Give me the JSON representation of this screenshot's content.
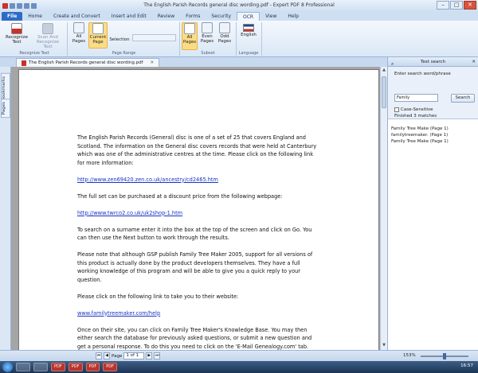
{
  "window": {
    "title": "The English Parish Records general disc wording.pdf - Expert PDF 8 Professional",
    "minimize": "–",
    "maximize": "□",
    "close": "✕"
  },
  "ribbon_tabs": [
    "File",
    "Home",
    "Create and Convert",
    "Insert and Edit",
    "Review",
    "Forms",
    "Security",
    "OCR",
    "View",
    "Help"
  ],
  "active_tab": "OCR",
  "ribbon": {
    "recognize_text": "Recognize Text",
    "scan_and_recognize": "Scan And Recognize Text",
    "group_recognize": "Recognize Text",
    "all_pages": "All Pages",
    "current_page": "Current Page",
    "selection": "Selection",
    "group_page_range": "Page Range",
    "subset_all": "All Pages",
    "subset_even": "Even Pages",
    "subset_odd": "Odd Pages",
    "group_subset": "Subset",
    "language": "English",
    "group_language": "Language"
  },
  "doc_tab": "The English Parish Records general disc wording.pdf",
  "left_tabs": {
    "bookmarks": "Bookmarks",
    "pages": "Pages"
  },
  "document": {
    "p1": "The English Parish Records (General) disc is one of a set of 25 that covers England and Scotland. The information on the General disc covers records that were held at Canterbury which was one of the administrative centres at the time. Please click on the following link for more information:",
    "link1": "http://www.zen69420.zen.co.uk/ancestry/cd2465.htm",
    "p2": "The full set can be purchased at a discount price from the following webpage:",
    "link2": "http://www.twrco2.co.uk/uk2shop-1.htm",
    "p3": "To search on a surname enter it into the box at the top of the screen and click on Go. You can then use the Next button to work through the results.",
    "p4": "Please note that although GSP publish Family Tree Maker 2005, support for all versions of this product is actually done by the product developers themselves. They have a full working knowledge of this program and will be able to give you a quick reply to your question.",
    "p5": "Please click on the following link to take you to their website:",
    "link3": "www.familytreemaker.com/help",
    "p6": "Once on their site, you can click on Family Tree Maker's Knowledge Base. You may then either search the database for previously asked questions, or submit a new question and get a personal response. To do this you need to click on the 'E-Mail Genealogy.com' tab. From here you can complete an enquiry form that goes straight to the FTM technicians."
  },
  "search_panel": {
    "title": "Text search",
    "label": "Enter search word/phrase",
    "query": "Family",
    "button": "Search",
    "case_sensitive": "Case-Sensitive",
    "status": "Finished 3 matches",
    "results": [
      "Family Tree Make (Page 1)",
      "familytreemaker. (Page 1)",
      "Family Tree Make (Page 1)"
    ]
  },
  "status": {
    "page_label": "Page",
    "page_value": "1 of 1",
    "zoom": "153%"
  },
  "taskbar": {
    "items": [
      "PDF",
      "PDF",
      "PDF",
      "PDF"
    ],
    "time": "16:57"
  }
}
